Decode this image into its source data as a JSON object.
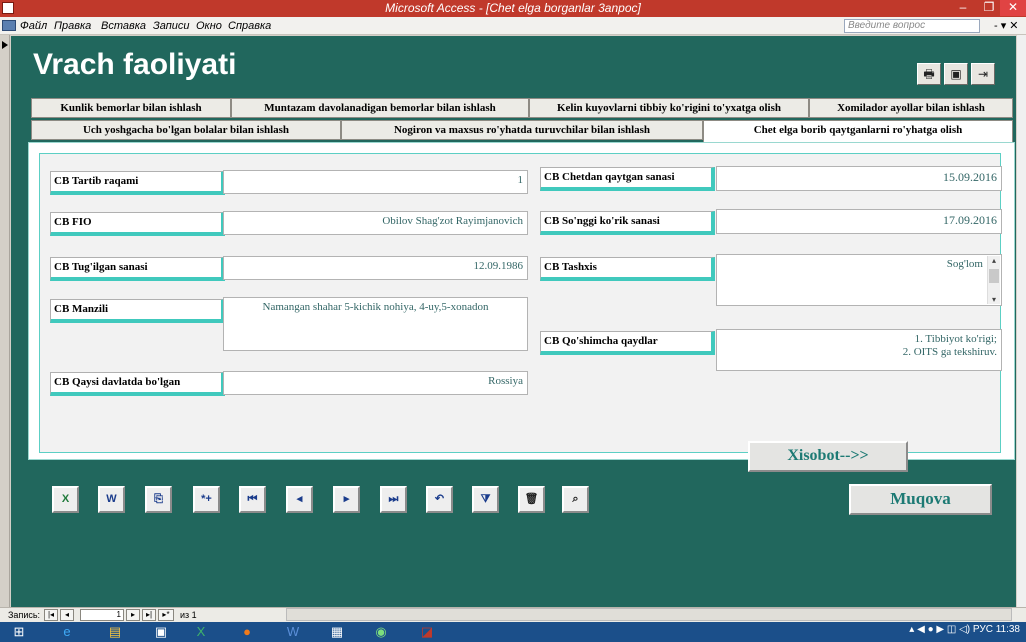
{
  "window": {
    "title": "Microsoft Access - [Chet elga borganlar 3anpoc]",
    "minimize": "–",
    "restore": "❐",
    "close": "✕"
  },
  "menu": {
    "items": [
      "Файл",
      "Правка",
      "Вставка",
      "Записи",
      "Окно",
      "Справка"
    ],
    "help_placeholder": "Введите вопрос",
    "mdi_controls": "- ▾ ✕"
  },
  "form": {
    "title": "Vrach faoliyati",
    "toolbar": [
      {
        "icon": "printer-icon",
        "glyph": "🖶"
      },
      {
        "icon": "save-icon",
        "glyph": "▣"
      },
      {
        "icon": "exit-icon",
        "glyph": "⇥"
      }
    ],
    "tabs_row1": [
      "Kunlik bemorlar bilan ishlash",
      "Muntazam davolanadigan bemorlar bilan ishlash",
      "Kelin kuyovlarni tibbiy ko'rigini to'yxatga olish",
      "Xomilador ayollar bilan ishlash"
    ],
    "tabs_row2": [
      "Uch yoshgacha bo'lgan bolalar bilan ishlash",
      "Nogiron va maxsus ro'yhatda turuvchilar bilan ishlash",
      "Chet elga borib qaytganlarni ro'yhatga olish"
    ],
    "fields": {
      "tartib_label": "CB Tartib raqami",
      "tartib_value": "1",
      "fio_label": "CB FIO",
      "fio_value": "Obilov Shag'zot Rayimjanovich",
      "tugilgan_label": "CB Tug'ilgan sanasi",
      "tugilgan_value": "12.09.1986",
      "manzil_label": "CB Manzili",
      "manzil_value": "Namangan shahar 5-kichik nohiya, 4-uy,5-xonadon",
      "davlat_label": "CB Qaysi davlatda bo'lgan",
      "davlat_value": "Rossiya",
      "qaytgan_label": "CB Chetdan qaytgan sanasi",
      "qaytgan_value": "15.09.2016",
      "korik_label": "CB So'nggi ko'rik sanasi",
      "korik_value": "17.09.2016",
      "tashxis_label": "CB Tashxis",
      "tashxis_value": "Sog'lom",
      "qoshimcha_label": "CB Qo'shimcha qaydlar",
      "qoshimcha_line1": "1. Tibbiyot ko'rigi;",
      "qoshimcha_line2": "2. OITS ga tekshiruv."
    },
    "report_button": "Xisobot-->>",
    "muqova_button": "Muqova",
    "nav_buttons": [
      {
        "name": "excel-icon",
        "glyph": "X"
      },
      {
        "name": "word-icon",
        "glyph": "W"
      },
      {
        "name": "copy-icon",
        "glyph": "⎘"
      },
      {
        "name": "new-record-icon",
        "glyph": "*+"
      },
      {
        "name": "first-record-icon",
        "glyph": "⏮"
      },
      {
        "name": "prev-record-icon",
        "glyph": "◂"
      },
      {
        "name": "next-record-icon",
        "glyph": "▸"
      },
      {
        "name": "last-record-icon",
        "glyph": "⏭"
      },
      {
        "name": "undo-icon",
        "glyph": "↶"
      },
      {
        "name": "filter-icon",
        "glyph": "⧩"
      },
      {
        "name": "delete-icon",
        "glyph": "🗑"
      },
      {
        "name": "find-icon",
        "glyph": "⌕"
      }
    ]
  },
  "record_nav": {
    "label": "Запись:",
    "current": "1",
    "of_text": "из 1"
  },
  "taskbar": {
    "tray_lang": "РУС",
    "time": "11:38"
  }
}
